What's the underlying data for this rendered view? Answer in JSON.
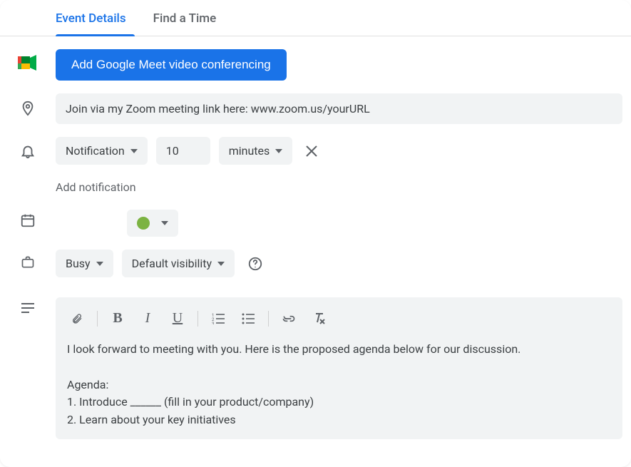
{
  "tabs": {
    "details": "Event Details",
    "findTime": "Find a Time"
  },
  "meet": {
    "addButton": "Add Google Meet video conferencing"
  },
  "location": {
    "value": "Join via my Zoom meeting link here: www.zoom.us/yourURL"
  },
  "notification": {
    "type": "Notification",
    "number": "10",
    "unit": "minutes",
    "addAnother": "Add notification"
  },
  "availability": {
    "status": "Busy",
    "visibility": "Default visibility"
  },
  "colors": {
    "eventColor": "#7cb342"
  },
  "description": {
    "intro": "I look forward to meeting with you. Here is the proposed agenda below for our discussion.",
    "agendaHeader": "Agenda:",
    "item1": "1. Introduce ______ (fill in your product/company)",
    "item2": "2. Learn about your key initiatives"
  }
}
